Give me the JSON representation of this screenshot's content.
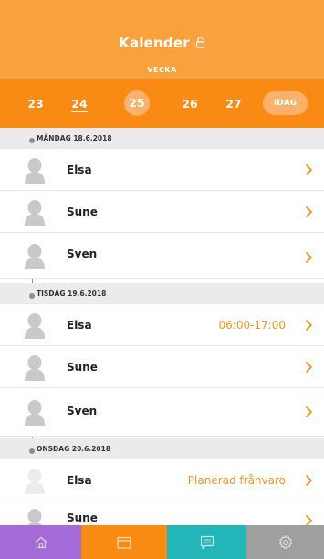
{
  "header": {
    "title": "Kalender",
    "subtitle": "VECKA"
  },
  "weeks": {
    "items": [
      "23",
      "24",
      "25",
      "26",
      "27"
    ],
    "current": "25",
    "today_label": "IDAG"
  },
  "days": [
    {
      "label": "MÅNDAG 18.6.2018",
      "rows": [
        {
          "name": "Elsa",
          "status": ""
        },
        {
          "name": "Sune",
          "status": ""
        },
        {
          "name": "Sven",
          "status": ""
        }
      ]
    },
    {
      "label": "TISDAG 19.6.2018",
      "rows": [
        {
          "name": "Elsa",
          "status": "06:00-17:00"
        },
        {
          "name": "Sune",
          "status": ""
        },
        {
          "name": "Sven",
          "status": ""
        }
      ]
    },
    {
      "label": "ONSDAG 20.6.2018",
      "rows": [
        {
          "name": "Elsa",
          "status": "Planerad frånvaro"
        },
        {
          "name": "Sune",
          "status": ""
        }
      ]
    }
  ],
  "tabs": [
    {
      "icon": "home-icon",
      "color": "#a36ad8"
    },
    {
      "icon": "calendar-icon",
      "color": "#f98b14"
    },
    {
      "icon": "chat-icon",
      "color": "#24b5b8"
    },
    {
      "icon": "gear-icon",
      "color": "#9f9f9f"
    }
  ],
  "colors": {
    "header": "#f9a23d",
    "weekbar": "#f98b14",
    "accent": "#f7931e",
    "dayheader": "#ebebeb"
  }
}
